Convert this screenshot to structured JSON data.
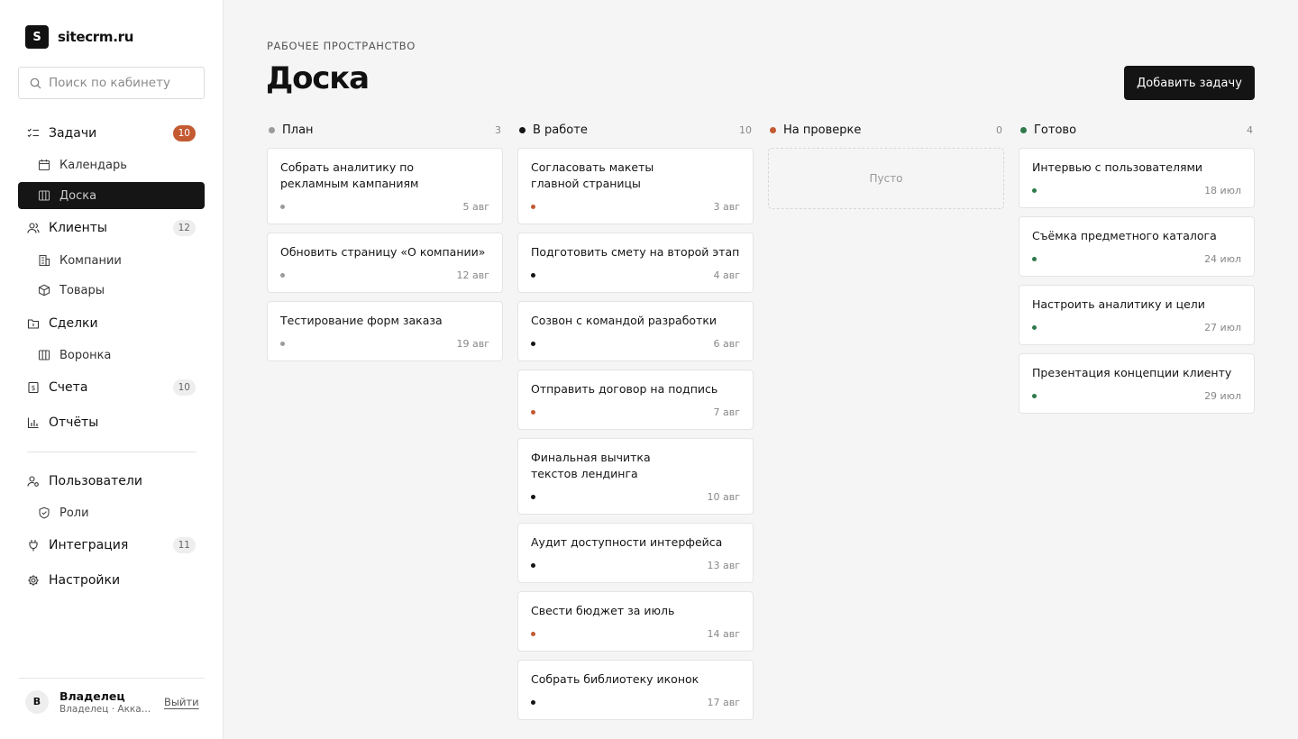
{
  "brand": {
    "logo_letter": "S",
    "name": "sitecrm.ru"
  },
  "search": {
    "placeholder": "Поиск по кабинету"
  },
  "nav": {
    "tasks": {
      "label": "Задачи",
      "badge": "10"
    },
    "calendar": {
      "label": "Календарь"
    },
    "board": {
      "label": "Доска"
    },
    "clients": {
      "label": "Клиенты",
      "badge": "12"
    },
    "companies": {
      "label": "Компании"
    },
    "products": {
      "label": "Товары"
    },
    "deals": {
      "label": "Сделки"
    },
    "funnel": {
      "label": "Воронка"
    },
    "invoices": {
      "label": "Счета",
      "badge": "10"
    },
    "reports": {
      "label": "Отчёты"
    },
    "users": {
      "label": "Пользователи"
    },
    "roles": {
      "label": "Роли"
    },
    "integration": {
      "label": "Интеграция",
      "badge": "11"
    },
    "settings": {
      "label": "Настройки"
    }
  },
  "user": {
    "avatar_letter": "В",
    "name": "Владелец",
    "subtitle": "Владелец · Аккаунт",
    "logout_label": "Выйти"
  },
  "header": {
    "eyebrow": "РАБОЧЕЕ ПРОСТРАНСТВО",
    "title": "Доска",
    "add_button": "Добавить задачу"
  },
  "colors": {
    "gray": "#9b9b9b",
    "black": "#151515",
    "orange": "#c45a32",
    "green": "#2f7a4a"
  },
  "columns": [
    {
      "name": "План",
      "count": "3",
      "color": "#9b9b9b",
      "cards": [
        {
          "title": "Собрать аналитику по рекламным кампаниям",
          "date": "5 авг",
          "dot": "#9b9b9b",
          "narrow": true
        },
        {
          "title": "Обновить страницу «О компании»",
          "date": "12 авг",
          "dot": "#9b9b9b"
        },
        {
          "title": "Тестирование форм заказа",
          "date": "19 авг",
          "dot": "#9b9b9b"
        }
      ]
    },
    {
      "name": "В работе",
      "count": "10",
      "color": "#151515",
      "cards": [
        {
          "title": "Согласовать макеты главной страницы",
          "date": "3 авг",
          "dot": "#c45a32",
          "narrow": true
        },
        {
          "title": "Подготовить смету на второй этап",
          "date": "4 авг",
          "dot": "#151515"
        },
        {
          "title": "Созвон с командой разработки",
          "date": "6 авг",
          "dot": "#151515"
        },
        {
          "title": "Отправить договор на подпись",
          "date": "7 авг",
          "dot": "#c45a32"
        },
        {
          "title": "Финальная вычитка текстов лендинга",
          "date": "10 авг",
          "dot": "#151515",
          "narrow": true
        },
        {
          "title": "Аудит доступности интерфейса",
          "date": "13 авг",
          "dot": "#151515"
        },
        {
          "title": "Свести бюджет за июль",
          "date": "14 авг",
          "dot": "#c45a32"
        },
        {
          "title": "Собрать библиотеку иконок",
          "date": "17 авг",
          "dot": "#151515"
        }
      ]
    },
    {
      "name": "На проверке",
      "count": "0",
      "color": "#c45a32",
      "empty_label": "Пусто",
      "cards": []
    },
    {
      "name": "Готово",
      "count": "4",
      "color": "#2f7a4a",
      "cards": [
        {
          "title": "Интервью с пользователями",
          "date": "18 июл",
          "dot": "#2f7a4a"
        },
        {
          "title": "Съёмка предметного каталога",
          "date": "24 июл",
          "dot": "#2f7a4a"
        },
        {
          "title": "Настроить аналитику и цели",
          "date": "27 июл",
          "dot": "#2f7a4a"
        },
        {
          "title": "Презентация концепции клиенту",
          "date": "29 июл",
          "dot": "#2f7a4a"
        }
      ]
    }
  ]
}
